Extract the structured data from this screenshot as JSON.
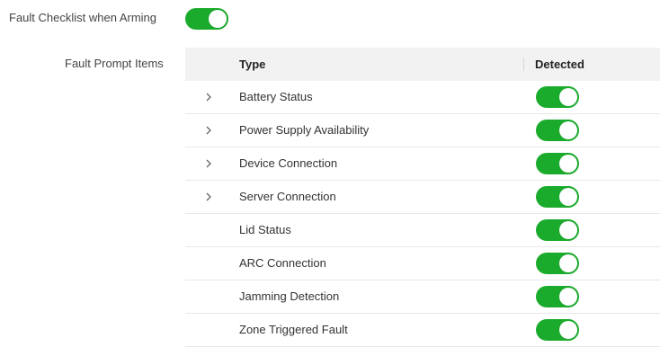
{
  "settings": {
    "fault_checklist": {
      "label": "Fault Checklist when Arming",
      "enabled": true
    },
    "fault_prompt": {
      "label": "Fault Prompt Items"
    }
  },
  "table": {
    "headers": {
      "type": "Type",
      "detected": "Detected"
    },
    "rows": [
      {
        "name": "Battery Status",
        "expandable": true,
        "detected": true
      },
      {
        "name": "Power Supply Availability",
        "expandable": true,
        "detected": true
      },
      {
        "name": "Device Connection",
        "expandable": true,
        "detected": true
      },
      {
        "name": "Server Connection",
        "expandable": true,
        "detected": true
      },
      {
        "name": "Lid Status",
        "expandable": false,
        "detected": true
      },
      {
        "name": "ARC Connection",
        "expandable": false,
        "detected": true
      },
      {
        "name": "Jamming Detection",
        "expandable": false,
        "detected": true
      },
      {
        "name": "Zone Triggered Fault",
        "expandable": false,
        "detected": true
      }
    ]
  },
  "colors": {
    "toggle_on": "#1aab2c",
    "header_bg": "#f2f2f2"
  },
  "icons": {
    "expand": "chevron-right-icon"
  }
}
